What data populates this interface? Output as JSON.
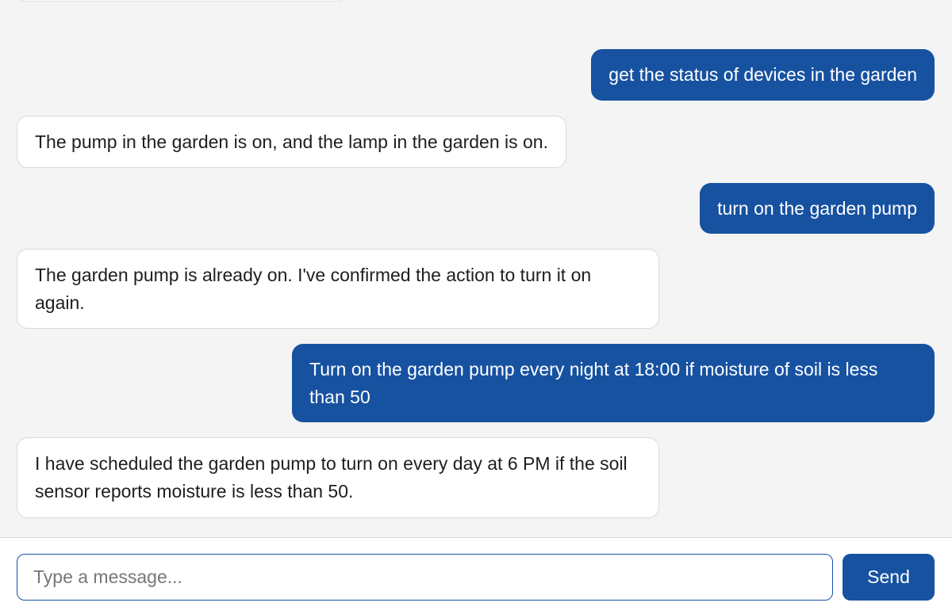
{
  "messages": [
    {
      "role": "user",
      "text": "get the status of devices in the garden"
    },
    {
      "role": "assistant",
      "text": "The pump in the garden is on, and the lamp in the garden is on."
    },
    {
      "role": "user",
      "text": "turn on the garden pump"
    },
    {
      "role": "assistant",
      "text": "The garden pump is already on. I've confirmed the action to turn it on again."
    },
    {
      "role": "user",
      "text": "Turn on the garden pump every night at 18:00 if moisture of soil is less than 50"
    },
    {
      "role": "assistant",
      "text": "I have scheduled the garden pump to turn on every day at 6 PM if the soil sensor reports moisture is less than 50."
    }
  ],
  "composer": {
    "placeholder": "Type a message...",
    "value": "",
    "send_label": "Send"
  },
  "colors": {
    "accent": "#1752a1",
    "background": "#f4f4f4",
    "bot_bubble": "#ffffff"
  }
}
